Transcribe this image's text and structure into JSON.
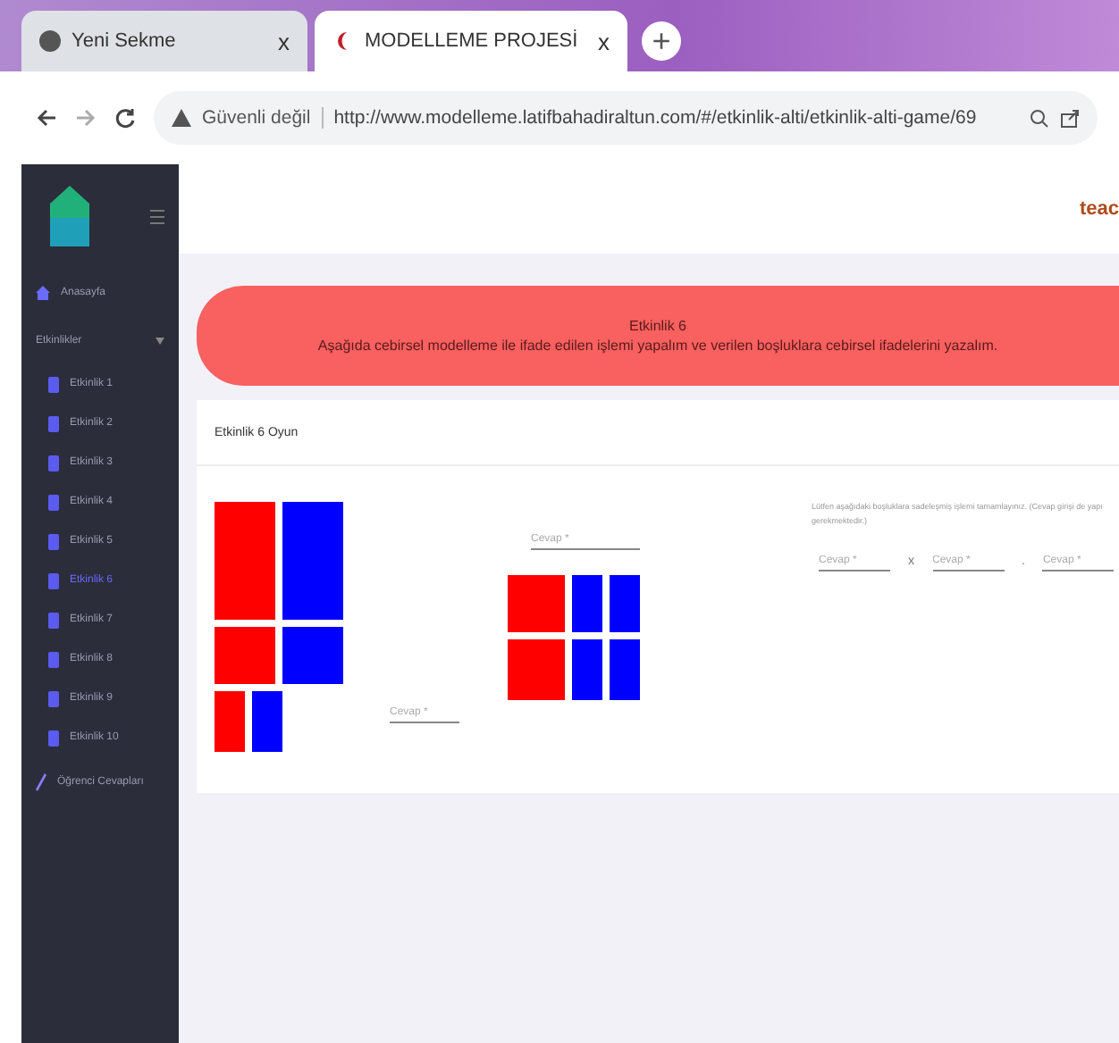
{
  "browser": {
    "tabs": [
      {
        "title": "Yeni Sekme",
        "close": "x",
        "selected": false
      },
      {
        "title": "MODELLEME PROJESİ",
        "close": "x",
        "selected": true
      }
    ],
    "new_tab": "+",
    "security": "Güvenli değil",
    "url": "http://www.modelleme.latifbahadiraltun.com/#/etkinlik-alti/etkinlik-alti-game/69"
  },
  "header": {
    "user": "teac"
  },
  "sidebar": {
    "items": [
      {
        "label": "Anasayfa",
        "kind": "home"
      },
      {
        "label": "Etkinlikler",
        "kind": "group",
        "expanded": true,
        "children": [
          {
            "label": "Etkinlik 1",
            "selected": false
          },
          {
            "label": "Etkinlik 2",
            "selected": false
          },
          {
            "label": "Etkinlik 3",
            "selected": false
          },
          {
            "label": "Etkinlik 4",
            "selected": false
          },
          {
            "label": "Etkinlik 5",
            "selected": false
          },
          {
            "label": "Etkinlik 6",
            "selected": true
          },
          {
            "label": "Etkinlik 7",
            "selected": false
          },
          {
            "label": "Etkinlik 8",
            "selected": false
          },
          {
            "label": "Etkinlik 9",
            "selected": false
          },
          {
            "label": "Etkinlik 10",
            "selected": false
          }
        ]
      },
      {
        "label": "Öğrenci Cevapları",
        "kind": "answers"
      }
    ]
  },
  "banner": {
    "title": "Etkinlik 6",
    "text": "Aşağıda cebirsel modelleme ile ifade edilen işlemi yapalım ve verilen boşluklara cebirsel ifadelerini yazalım."
  },
  "card": {
    "title": "Etkinlik 6 Oyun",
    "left_field": {
      "placeholder": "Cevap *"
    },
    "top_field": {
      "placeholder": "Cevap *"
    },
    "instruction": [
      "Lütfen aşağıdaki boşluklara sadeleşmiş işlemi tamamlayınız. (Cevap girişi de yapı",
      "gerekmektedir.)"
    ],
    "answers": [
      {
        "placeholder": "Cevap *"
      },
      {
        "separator": "x",
        "placeholder": "Cevap *"
      },
      {
        "separator": ".",
        "placeholder": "Cevap *"
      }
    ]
  }
}
